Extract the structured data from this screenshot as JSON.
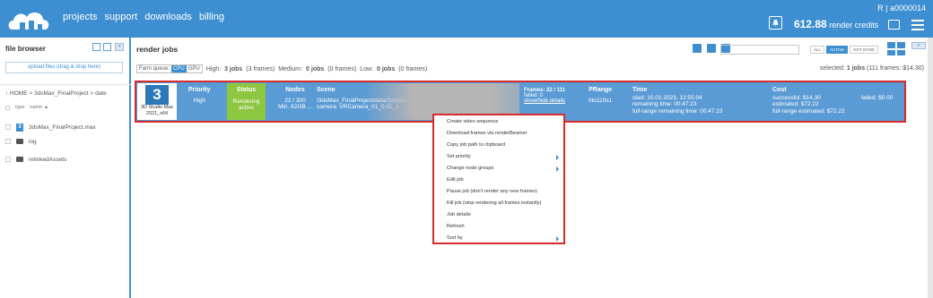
{
  "colors": {
    "primary": "#3d8fd1",
    "status_green": "#8dc63f",
    "highlight_red": "#d42b2b",
    "row_blue": "#5b9bd5"
  },
  "header": {
    "nav": [
      "projects",
      "support",
      "downloads",
      "billing"
    ],
    "account": "R | a0000014",
    "credits_value": "612.88",
    "credits_label": "render credits"
  },
  "file_browser": {
    "title": "file browser",
    "upload_label": "upload files (drag & drop here)",
    "breadcrumb": "↑   HOME  >  3dsMax_FinalProject  >  date",
    "col_type": "type",
    "col_name": "name ▲",
    "items": [
      {
        "name": "3dsMax_FinalProject.max",
        "icon": "3ds-max-icon"
      },
      {
        "name": "log",
        "icon": "folder-icon"
      },
      {
        "name": "relinkedAssets",
        "icon": "folder-icon"
      }
    ]
  },
  "jobs": {
    "title": "render jobs",
    "search_placeholder": "",
    "filters": [
      "ALL",
      "ACTIVE",
      "NOT DONE"
    ],
    "active_filter": "ACTIVE",
    "queue_label": "Farm queue:",
    "queue_cpu": "CPU",
    "queue_gpu": "GPU",
    "high": {
      "label": "High:",
      "jobs": "3 jobs",
      "frames": "(3 frames)"
    },
    "medium": {
      "label": "Medium:",
      "jobs": "0 jobs",
      "frames": "(0 frames)"
    },
    "low": {
      "label": "Low:",
      "jobs": "0 jobs",
      "frames": "(0 frames)"
    },
    "selected_prefix": "selected:",
    "selected_count": "1 jobs",
    "selected_detail": "(111 frames: $14.30)"
  },
  "job": {
    "app_name": "3D Studio Max",
    "app_version": "2021_x64",
    "priority_header": "Priority",
    "priority_value": "High",
    "status_header": "Status",
    "status_line1": "Rendering",
    "status_line2": "active",
    "nodes_header": "Nodes",
    "nodes_line1": "22 / 300",
    "nodes_line2": "Min. 62GB ...",
    "scene_header": "Scene",
    "scene_path": "/3dsMax_FinalProject/data/3dsMax_FinalProject.max",
    "scene_camera": "camera: VRCamera_01_0-11_1",
    "frames_header": "Frames: 22 / 111",
    "frames_failed": "failed: 0",
    "frames_link": "show/hide details",
    "prange_header": "PRange",
    "prange_value": "0to110s1",
    "time_header": "Time",
    "time_start": "start: 10.01.2023, 12:55:04",
    "time_remaining": "remaining time: 00:47:23",
    "time_full": "full-range remaining time: 00:47:23",
    "cost_header": "Cost",
    "cost_success": "successful: $14.30",
    "cost_estimated": "estimated: $72.22",
    "cost_full": "full-range estimated: $72.22",
    "cost_failed": "failed: $0.00"
  },
  "context_menu": [
    {
      "label": "Create video sequence",
      "submenu": false
    },
    {
      "label": "Download frames via renderBeamer",
      "submenu": false
    },
    {
      "label": "Copy job path to clipboard",
      "submenu": false
    },
    {
      "label": "Set priority",
      "submenu": true
    },
    {
      "label": "Change node groups",
      "submenu": true
    },
    {
      "label": "Edit job",
      "submenu": false
    },
    {
      "label": "Pause job (don't render any new frames)",
      "submenu": false
    },
    {
      "label": "Kill job (stop rendering all frames instantly)",
      "submenu": false
    },
    {
      "label": "Job details",
      "submenu": false
    },
    {
      "label": "Refresh",
      "submenu": false
    },
    {
      "label": "Sort by",
      "submenu": true
    }
  ]
}
